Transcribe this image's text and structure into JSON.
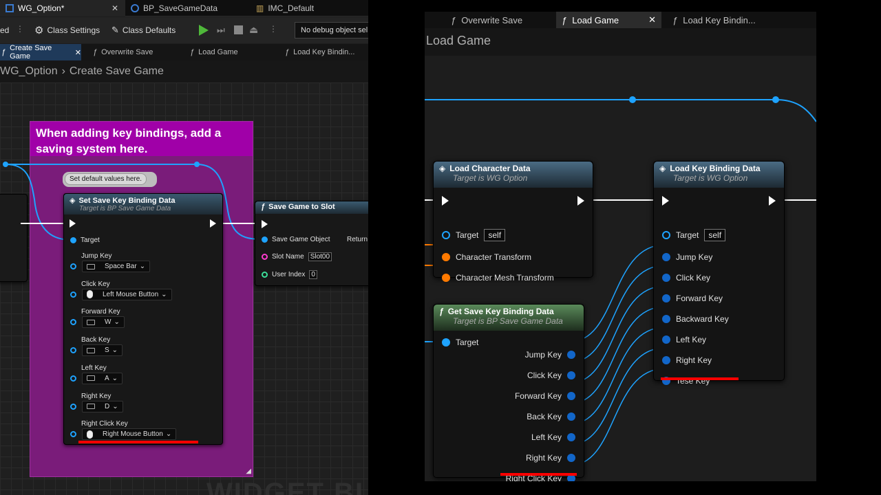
{
  "left": {
    "doc_tabs": [
      {
        "label": "WG_Option*"
      },
      {
        "label": "BP_SaveGameData"
      },
      {
        "label": "IMC_Default"
      }
    ],
    "toolbar": {
      "compile_status": "ed",
      "class_settings": "Class Settings",
      "class_defaults": "Class Defaults",
      "debug_object": "No debug object sel"
    },
    "function_tabs": [
      {
        "label": "Create Save Game"
      },
      {
        "label": "Overwrite Save"
      },
      {
        "label": "Load Game"
      },
      {
        "label": "Load Key Bindin..."
      }
    ],
    "breadcrumb": {
      "root": "WG_Option",
      "current": "Create Save Game"
    },
    "comment": "When adding key bindings, add a saving system here.",
    "tooltip": "Set default values here.",
    "set_node": {
      "title": "Set Save Key Binding Data",
      "subtitle": "Target is BP Save Game Data",
      "target": "Target",
      "pins": [
        {
          "label": "Jump Key",
          "value": "Space Bar",
          "icon": "keyboard-icon"
        },
        {
          "label": "Click Key",
          "value": "Left Mouse Button",
          "icon": "mouse-icon"
        },
        {
          "label": "Forward Key",
          "value": "W",
          "icon": "keyboard-icon"
        },
        {
          "label": "Back Key",
          "value": "S",
          "icon": "keyboard-icon"
        },
        {
          "label": "Left Key",
          "value": "A",
          "icon": "keyboard-icon"
        },
        {
          "label": "Right Key",
          "value": "D",
          "icon": "keyboard-icon"
        },
        {
          "label": "Right Click Key",
          "value": "Right Mouse Button",
          "icon": "mouse-icon"
        }
      ]
    },
    "save_node": {
      "title": "Save Game to Slot",
      "save_game_object": "Save Game Object",
      "return": "Return",
      "slot_name_label": "Slot Name",
      "slot_name_value": "Slot00",
      "user_index_label": "User Index",
      "user_index_value": "0"
    },
    "watermark": "WIDGET BL"
  },
  "right": {
    "tabs": [
      {
        "label": "Overwrite Save"
      },
      {
        "label": "Load Game"
      },
      {
        "label": "Load Key Bindin..."
      }
    ],
    "graph_title": "Load Game",
    "load_char_node": {
      "title": "Load Character Data",
      "subtitle": "Target is WG Option",
      "target": "Target",
      "self": "self",
      "pins": [
        "Character Transform",
        "Character Mesh Transform"
      ]
    },
    "load_key_node": {
      "title": "Load Key Binding Data",
      "subtitle": "Target is WG Option",
      "target": "Target",
      "self": "self",
      "pins": [
        "Jump Key",
        "Click Key",
        "Forward Key",
        "Backward Key",
        "Left Key",
        "Right Key",
        "Tese Key"
      ]
    },
    "get_node": {
      "title": "Get Save Key Binding Data",
      "subtitle": "Target is BP Save Game Data",
      "target": "Target",
      "pins": [
        "Jump Key",
        "Click Key",
        "Forward Key",
        "Back Key",
        "Left Key",
        "Right Key",
        "Right Click Key"
      ]
    }
  },
  "colors": {
    "wire_blue": "#1ea3ff",
    "comment_purple": "#a000a8",
    "highlight_red": "#ff0000",
    "orange_pin": "#ff7a00"
  }
}
